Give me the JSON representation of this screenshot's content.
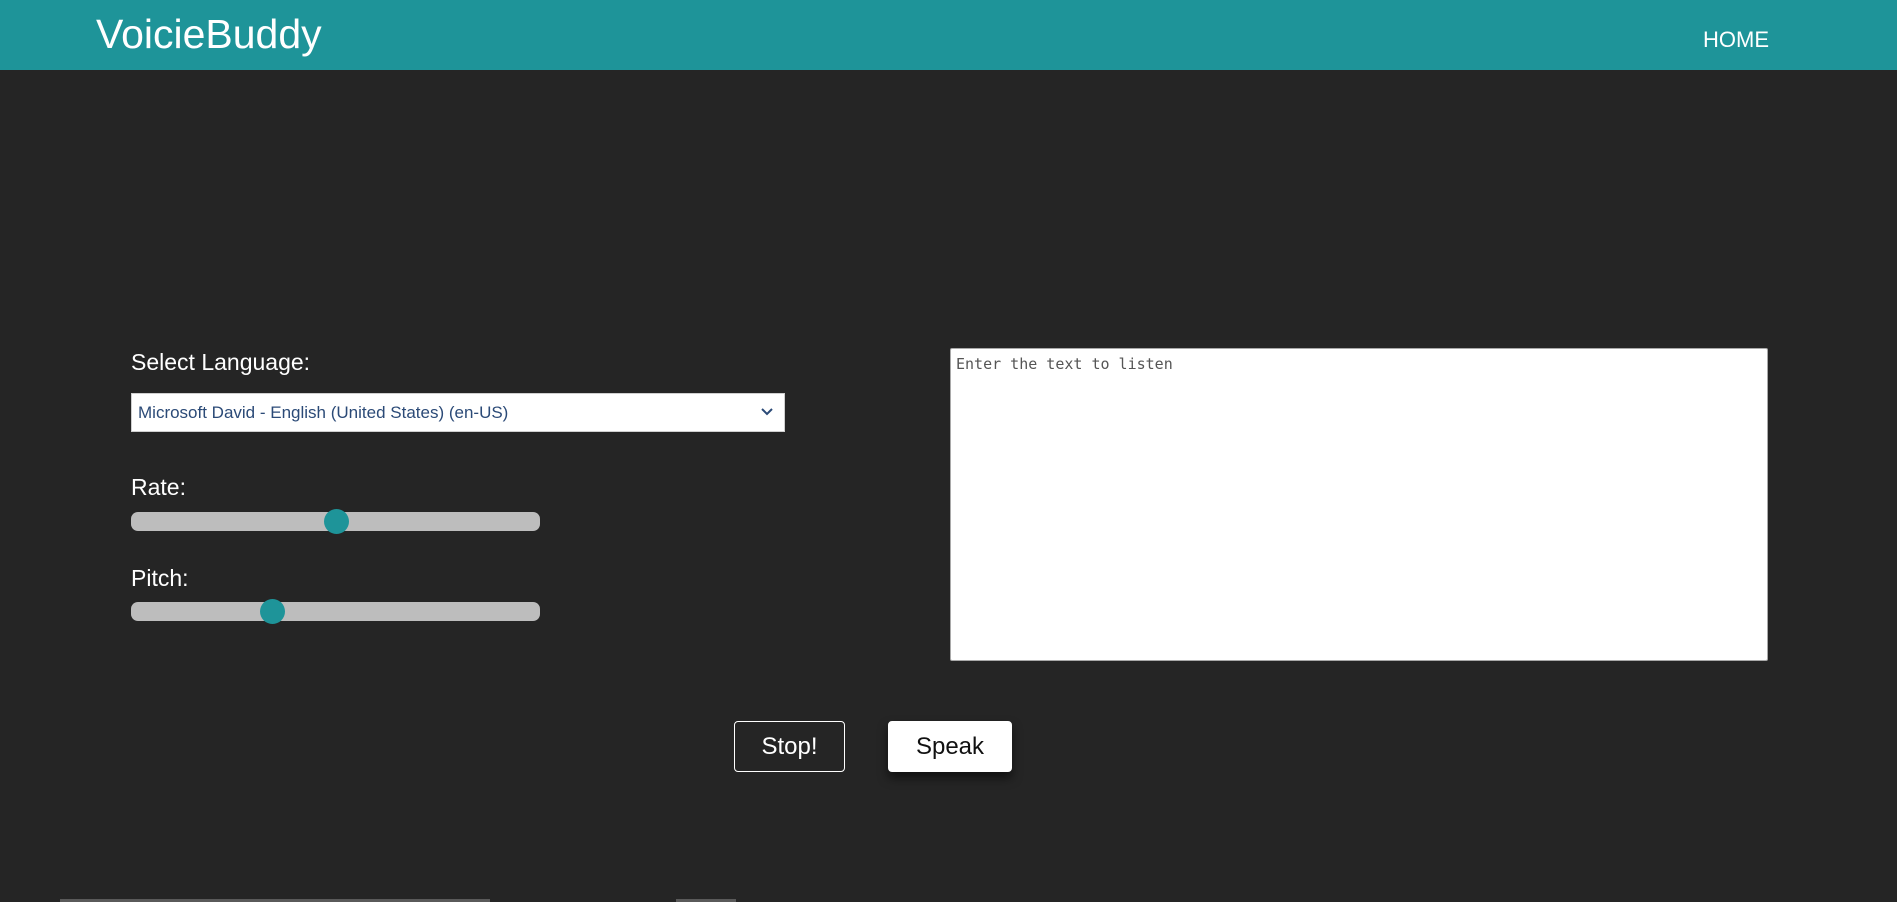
{
  "header": {
    "brand": "VoicieBuddy",
    "nav": [
      {
        "label": "HOME"
      }
    ]
  },
  "form": {
    "language_label": "Select Language:",
    "language_selected": "Microsoft David - English (United States) (en-US)",
    "rate_label": "Rate:",
    "rate_fraction": 0.5,
    "pitch_label": "Pitch:",
    "pitch_fraction": 0.345,
    "text_placeholder": "Enter the text to listen",
    "text_value": ""
  },
  "buttons": {
    "stop_label": "Stop!",
    "speak_label": "Speak"
  },
  "colors": {
    "accent": "#1e9499",
    "background": "#252525",
    "track": "#bdbdbd"
  },
  "icons": {
    "select_chevron": "chevron-down-icon"
  }
}
